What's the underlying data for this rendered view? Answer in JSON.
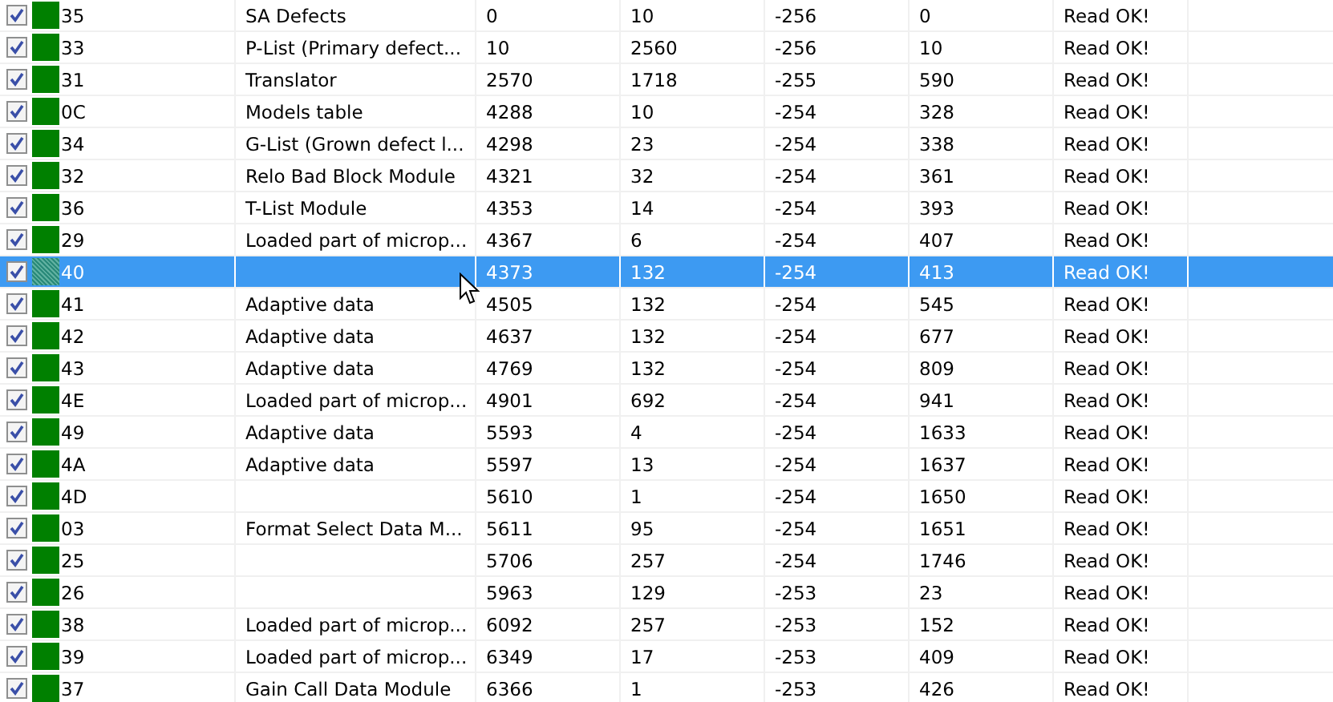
{
  "table": {
    "rows": [
      {
        "checked": true,
        "selected": false,
        "column_1": "35",
        "column_2": "SA Defects",
        "column_3": "0",
        "column_4": "10",
        "column_5": "-256",
        "column_6": "0",
        "column_7": "Read OK!"
      },
      {
        "checked": true,
        "selected": false,
        "column_1": "33",
        "column_2": "P-List (Primary defect...",
        "column_3": "10",
        "column_4": "2560",
        "column_5": "-256",
        "column_6": "10",
        "column_7": "Read OK!"
      },
      {
        "checked": true,
        "selected": false,
        "column_1": "31",
        "column_2": "Translator",
        "column_3": "2570",
        "column_4": "1718",
        "column_5": "-255",
        "column_6": "590",
        "column_7": "Read OK!"
      },
      {
        "checked": true,
        "selected": false,
        "column_1": "0C",
        "column_2": "Models table",
        "column_3": "4288",
        "column_4": "10",
        "column_5": "-254",
        "column_6": "328",
        "column_7": "Read OK!"
      },
      {
        "checked": true,
        "selected": false,
        "column_1": "34",
        "column_2": "G-List (Grown defect l...",
        "column_3": "4298",
        "column_4": "23",
        "column_5": "-254",
        "column_6": "338",
        "column_7": "Read OK!"
      },
      {
        "checked": true,
        "selected": false,
        "column_1": "32",
        "column_2": "Relo Bad Block Module",
        "column_3": "4321",
        "column_4": "32",
        "column_5": "-254",
        "column_6": "361",
        "column_7": "Read OK!"
      },
      {
        "checked": true,
        "selected": false,
        "column_1": "36",
        "column_2": "T-List Module",
        "column_3": "4353",
        "column_4": "14",
        "column_5": "-254",
        "column_6": "393",
        "column_7": "Read OK!"
      },
      {
        "checked": true,
        "selected": false,
        "column_1": "29",
        "column_2": "Loaded part of microp...",
        "column_3": "4367",
        "column_4": "6",
        "column_5": "-254",
        "column_6": "407",
        "column_7": "Read OK!"
      },
      {
        "checked": true,
        "selected": true,
        "column_1": "40",
        "column_3": "4373",
        "column_4": "132",
        "column_5": "-254",
        "column_6": "413",
        "column_7": "Read OK!"
      },
      {
        "checked": true,
        "selected": false,
        "column_1": "41",
        "column_2": "Adaptive data",
        "column_3": "4505",
        "column_4": "132",
        "column_5": "-254",
        "column_6": "545",
        "column_7": "Read OK!"
      },
      {
        "checked": true,
        "selected": false,
        "column_1": "42",
        "column_2": "Adaptive data",
        "column_3": "4637",
        "column_4": "132",
        "column_5": "-254",
        "column_6": "677",
        "column_7": "Read OK!"
      },
      {
        "checked": true,
        "selected": false,
        "column_1": "43",
        "column_2": "Adaptive data",
        "column_3": "4769",
        "column_4": "132",
        "column_5": "-254",
        "column_6": "809",
        "column_7": "Read OK!"
      },
      {
        "checked": true,
        "selected": false,
        "column_1": "4E",
        "column_2": "Loaded part of microp...",
        "column_3": "4901",
        "column_4": "692",
        "column_5": "-254",
        "column_6": "941",
        "column_7": "Read OK!"
      },
      {
        "checked": true,
        "selected": false,
        "column_1": "49",
        "column_2": "Adaptive data",
        "column_3": "5593",
        "column_4": "4",
        "column_5": "-254",
        "column_6": "1633",
        "column_7": "Read OK!"
      },
      {
        "checked": true,
        "selected": false,
        "column_1": "4A",
        "column_2": "Adaptive data",
        "column_3": "5597",
        "column_4": "13",
        "column_5": "-254",
        "column_6": "1637",
        "column_7": "Read OK!"
      },
      {
        "checked": true,
        "selected": false,
        "column_1": "4D",
        "column_3": "5610",
        "column_4": "1",
        "column_5": "-254",
        "column_6": "1650",
        "column_7": "Read OK!"
      },
      {
        "checked": true,
        "selected": false,
        "column_1": "03",
        "column_2": "Format Select Data M...",
        "column_3": "5611",
        "column_4": "95",
        "column_5": "-254",
        "column_6": "1651",
        "column_7": "Read OK!"
      },
      {
        "checked": true,
        "selected": false,
        "column_1": "25",
        "column_3": "5706",
        "column_4": "257",
        "column_5": "-254",
        "column_6": "1746",
        "column_7": "Read OK!"
      },
      {
        "checked": true,
        "selected": false,
        "column_1": "26",
        "column_3": "5963",
        "column_4": "129",
        "column_5": "-253",
        "column_6": "23",
        "column_7": "Read OK!"
      },
      {
        "checked": true,
        "selected": false,
        "column_1": "38",
        "column_2": "Loaded part of microp...",
        "column_3": "6092",
        "column_4": "257",
        "column_5": "-253",
        "column_6": "152",
        "column_7": "Read OK!"
      },
      {
        "checked": true,
        "selected": false,
        "column_1": "39",
        "column_2": "Loaded part of microp...",
        "column_3": "6349",
        "column_4": "17",
        "column_5": "-253",
        "column_6": "409",
        "column_7": "Read OK!"
      },
      {
        "checked": true,
        "selected": false,
        "column_1": "37",
        "column_2": "Gain Call Data Module",
        "column_3": "6366",
        "column_4": "1",
        "column_5": "-253",
        "column_6": "426",
        "column_7": "Read OK!"
      }
    ]
  }
}
